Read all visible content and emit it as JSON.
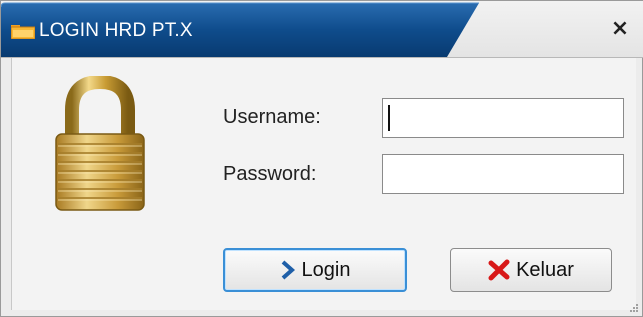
{
  "window": {
    "title": "LOGIN HRD PT.X",
    "close_glyph": "×",
    "title_icon": "folder-icon",
    "title_tab_color": "#0b3f7a"
  },
  "form": {
    "username_label": "Username:",
    "username_value": "",
    "password_label": "Password:",
    "password_value": ""
  },
  "buttons": {
    "login_label": "Login",
    "login_icon": "chevron-right-icon",
    "keluar_label": "Keluar",
    "keluar_icon": "red-x-icon"
  },
  "decor": {
    "lock_icon": "padlock-icon"
  }
}
